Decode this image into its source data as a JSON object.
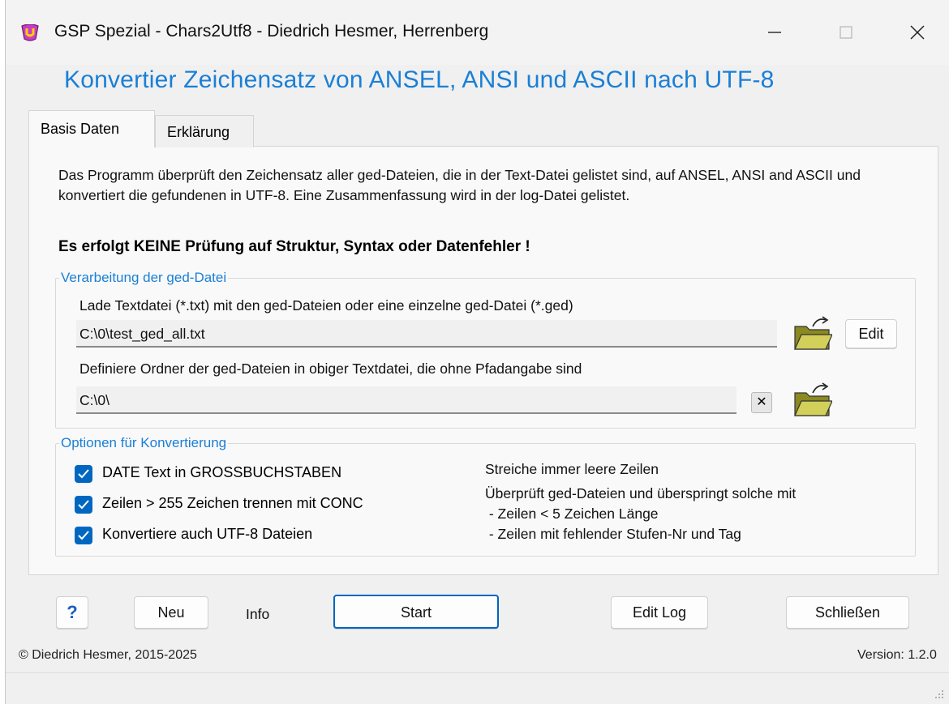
{
  "window": {
    "title": "GSP Spezial - Chars2Utf8  -  Diedrich Hesmer, Herrenberg"
  },
  "heading": "Konvertier Zeichensatz von ANSEL, ANSI und ASCII nach UTF-8",
  "tabs": [
    {
      "label": "Basis Daten",
      "active": true
    },
    {
      "label": "Erklärung",
      "active": false
    }
  ],
  "description": "Das Programm überprüft den Zeichensatz aller ged-Dateien, die in der Text-Datei gelistet sind, auf ANSEL, ANSI and ASCII und konvertiert die gefundenen in UTF-8. Eine Zusammenfassung wird in der log-Datei gelistet.",
  "warning": "Es erfolgt KEINE Prüfung auf Struktur, Syntax oder Datenfehler !",
  "processing": {
    "legend": "Verarbeitung der ged-Datei",
    "load_label": "Lade Textdatei (*.txt) mit den ged-Dateien oder eine einzelne ged-Datei (*.ged)",
    "load_value": "C:\\0\\test_ged_all.txt",
    "edit_label": "Edit",
    "folder_label": "Definiere Ordner der ged-Dateien in obiger Textdatei, die ohne Pfadangabe sind",
    "folder_value": "C:\\0\\",
    "clear_symbol": "✕"
  },
  "options": {
    "legend": "Optionen für Konvertierung",
    "checkboxes": [
      {
        "label": "DATE Text in GROSSBUCHSTABEN",
        "checked": true
      },
      {
        "label": "Zeilen > 255 Zeichen trennen mit CONC",
        "checked": true
      },
      {
        "label": "Konvertiere auch UTF-8 Dateien",
        "checked": true
      }
    ],
    "info_line1": "Streiche immer leere Zeilen",
    "info_line2": "Überprüft ged-Dateien und überspringt solche mit",
    "info_line3": " - Zeilen < 5 Zeichen Länge",
    "info_line4": " - Zeilen mit fehlender Stufen-Nr und Tag"
  },
  "buttons": {
    "help": "?",
    "new": "Neu",
    "info": "Info",
    "start": "Start",
    "edit_log": "Edit Log",
    "close": "Schließen"
  },
  "footer": {
    "copyright": "© Diedrich Hesmer,  2015-2025",
    "version": "Version: 1.2.0"
  },
  "colors": {
    "accent": "#1a7fd6",
    "checkbox": "#0067c0",
    "start_border": "#0067c0"
  }
}
